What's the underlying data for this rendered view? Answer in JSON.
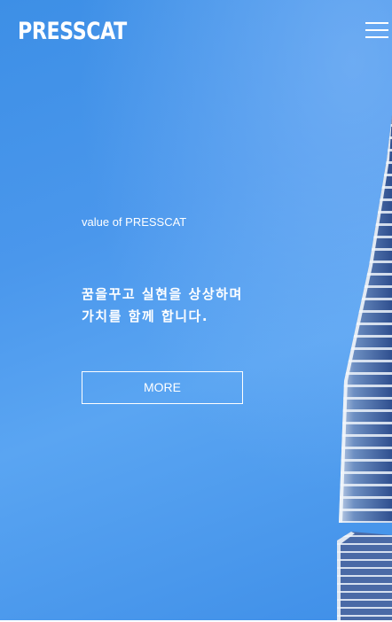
{
  "header": {
    "logo_text": "PRESSCAT",
    "menu_icon": "hamburger-menu-icon"
  },
  "hero": {
    "subtitle": "value of PRESSCAT",
    "headline_line1": "꿈을꾸고 실현을 상상하며",
    "headline_line2": "가치를 함께 합니다.",
    "more_label": "MORE",
    "background_image": "skyscraper-against-blue-sky"
  },
  "colors": {
    "sky_blue": "#3d8fe6",
    "text": "#ffffff"
  }
}
